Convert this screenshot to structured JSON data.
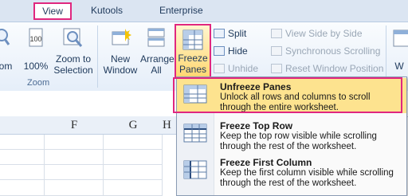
{
  "tabs": {
    "view": "View",
    "kutools": "Kutools",
    "enterprise": "Enterprise"
  },
  "ribbon": {
    "zoom_partial": "om",
    "zoom_100": "100%",
    "zoom_to_selection_line1": "Zoom to",
    "zoom_to_selection_line2": "Selection",
    "zoom_group_label": "Zoom",
    "new_window_line1": "New",
    "new_window_line2": "Window",
    "arrange_all_line1": "Arrange",
    "arrange_all_line2": "All",
    "freeze_panes_line1": "Freeze",
    "freeze_panes_line2": "Panes",
    "split": "Split",
    "hide": "Hide",
    "unhide": "Unhide",
    "view_side_by_side": "View Side by Side",
    "synchronous_scrolling": "Synchronous Scrolling",
    "reset_window_position": "Reset Window Position",
    "cut_off_label": "W"
  },
  "sheet": {
    "columns": [
      "F",
      "G",
      "H"
    ]
  },
  "menu": {
    "items": [
      {
        "title": "Unfreeze Panes",
        "desc": "Unlock all rows and columns to scroll through the entire worksheet."
      },
      {
        "title": "Freeze Top Row",
        "desc": "Keep the top row visible while scrolling through the rest of the worksheet."
      },
      {
        "title": "Freeze First Column",
        "desc": "Keep the first column visible while scrolling through the rest of the worksheet."
      }
    ]
  },
  "colors": {
    "highlight_border": "#e0277f",
    "menu_selected": "#fde38f",
    "ribbon_bg": "#e5eef9"
  }
}
